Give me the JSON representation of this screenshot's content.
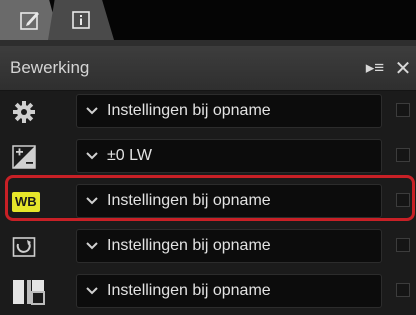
{
  "tabs": [
    {
      "icon": "edit-pencil-icon"
    },
    {
      "icon": "info-icon"
    }
  ],
  "header": {
    "title": "Bewerking",
    "menu_icon": "panel-menu-icon",
    "close_icon": "close-icon",
    "menu_glyph": "▸≡",
    "close_glyph": "✕"
  },
  "rows": [
    {
      "icon": "gear-icon",
      "value": "Instellingen bij opname",
      "checkbox": false
    },
    {
      "icon": "exposure-compensation-icon",
      "value": "±0 LW",
      "checkbox": false
    },
    {
      "icon": "white-balance-icon",
      "icon_text": "WB",
      "value": "Instellingen bij opname",
      "checkbox": false,
      "highlighted": true
    },
    {
      "icon": "picture-control-icon",
      "value": "Instellingen bij opname",
      "checkbox": false
    },
    {
      "icon": "active-d-lighting-icon",
      "value": "Instellingen bij opname",
      "checkbox": false
    }
  ],
  "colors": {
    "highlight_border": "#c82026",
    "wb_badge": "#e6e62a"
  }
}
